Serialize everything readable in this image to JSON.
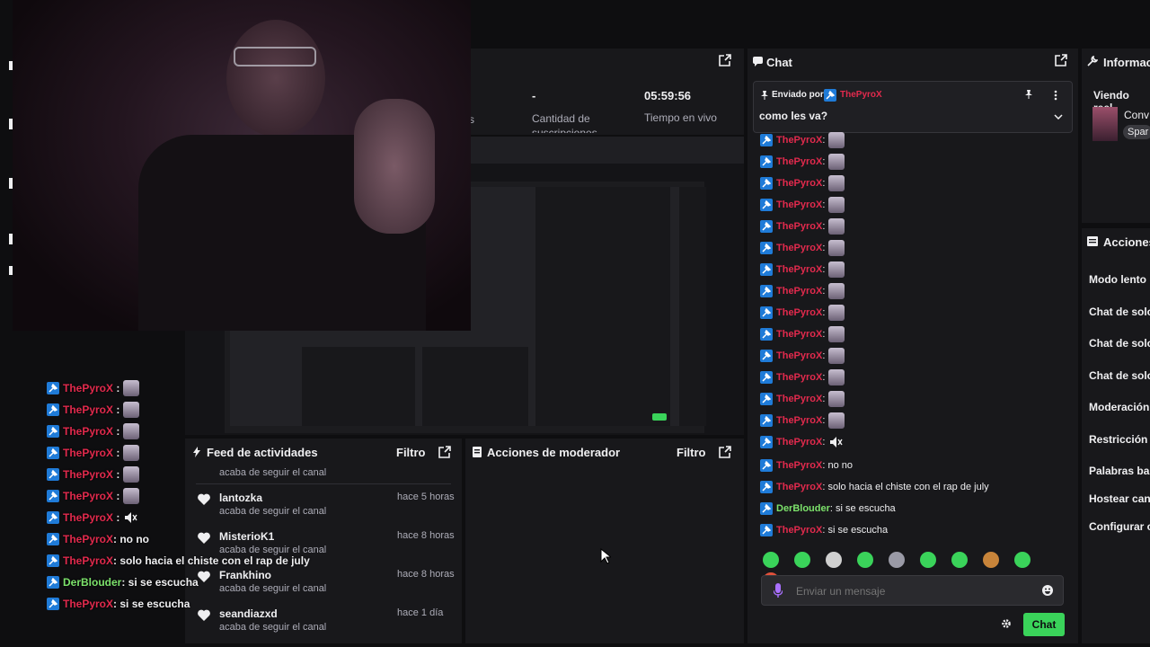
{
  "stats": {
    "subs_value": "-",
    "subs_label": "Cantidad de suscripciones",
    "uptime_value": "05:59:56",
    "uptime_label": "Tiempo en vivo",
    "partial_label": "s"
  },
  "chat": {
    "title": "Chat",
    "pinned_prefix": "Enviado por",
    "pinned_user": "ThePyroX",
    "pinned_message": "como les va?",
    "emote_messages_user": "ThePyroX",
    "messages": [
      {
        "user": "ThePyroX",
        "text": "no no",
        "color": "#e22a4d"
      },
      {
        "user": "ThePyroX",
        "text": "solo hacia el chiste con el rap de july",
        "color": "#e22a4d"
      },
      {
        "user": "DerBlouder",
        "text": "si se escucha",
        "color": "#7ce26b"
      },
      {
        "user": "ThePyroX",
        "text": "si se escucha",
        "color": "#e22a4d"
      }
    ],
    "input_placeholder": "Enviar un mensaje",
    "send_label": "Chat"
  },
  "info": {
    "title": "Informaci",
    "watching": "Viendo reel",
    "item_title": "Conv",
    "tag": "Spar"
  },
  "actions": {
    "title": "Acciones",
    "items": [
      "Modo lento",
      "Chat de solo",
      "Chat de solo",
      "Chat de solo",
      "Moderación",
      "Restricción c",
      "Palabras bar",
      "Hostear cana",
      "Configurar o"
    ]
  },
  "feed": {
    "title": "Feed de actividades",
    "filter": "Filtro",
    "partial_text": "acaba de seguir el canal",
    "items": [
      {
        "name": "lantozka",
        "time": "hace 5 horas",
        "sub": "acaba de seguir el canal"
      },
      {
        "name": "MisterioK1",
        "time": "hace 8 horas",
        "sub": "acaba de seguir el canal"
      },
      {
        "name": "Frankhino",
        "time": "hace 8 horas",
        "sub": "acaba de seguir el canal"
      },
      {
        "name": "seandiazxd",
        "time": "hace 1 día",
        "sub": "acaba de seguir el canal"
      }
    ]
  },
  "mod_actions": {
    "title": "Acciones de moderador",
    "filter": "Filtro"
  },
  "overlay_chat": {
    "emote_user": "ThePyroX",
    "messages": [
      {
        "user": "ThePyroX",
        "text": ": no no",
        "color": "#e22a4d"
      },
      {
        "user": "ThePyroX",
        "text": ": solo hacia el chiste con el rap de july",
        "color": "#e22a4d"
      },
      {
        "user": "DerBlouder",
        "text": ": si se escucha",
        "color": "#7ce26b"
      },
      {
        "user": "ThePyroX",
        "text": ": si se escucha",
        "color": "#e22a4d"
      }
    ]
  },
  "colors": {
    "accent": "#1f7bd8",
    "pyro": "#e22a4d",
    "green": "#3ad35a",
    "purple": "#a970ff"
  }
}
